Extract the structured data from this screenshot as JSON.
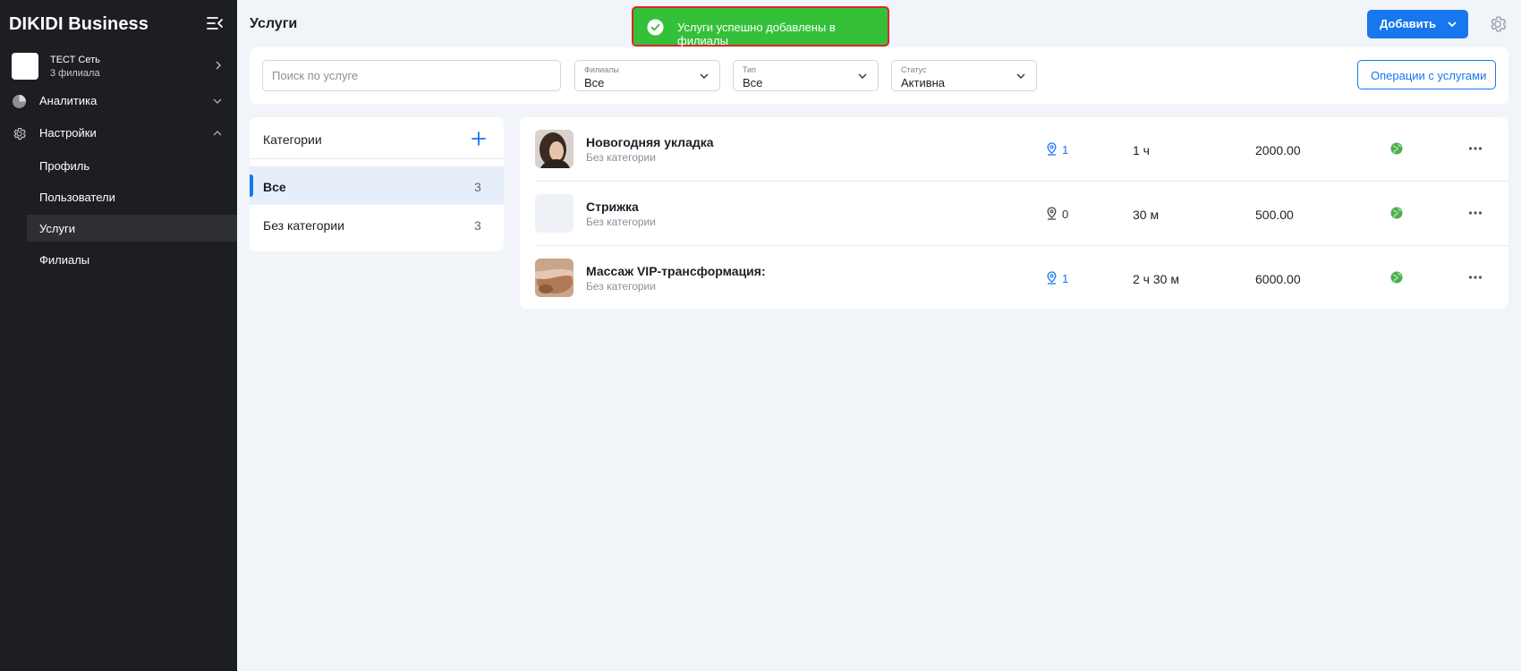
{
  "app": {
    "brand": "DIKIDI Business"
  },
  "org": {
    "name": "ТЕСТ Сеть",
    "subtitle": "3 филиала"
  },
  "nav": {
    "analytics": "Аналитика",
    "settings": "Настройки",
    "sub_items": [
      "Профиль",
      "Пользователи",
      "Услуги",
      "Филиалы"
    ],
    "active": "Услуги"
  },
  "header": {
    "title": "Услуги",
    "add_label": "Добавить"
  },
  "toast": {
    "text": "Услуги успешно добавлены в филиалы",
    "color": "#35c03a"
  },
  "filters": {
    "search_placeholder": "Поиск по услуге",
    "branches_caption": "Филиалы",
    "branches_value": "Все",
    "type_caption": "Тип",
    "type_value": "Все",
    "status_caption": "Статус",
    "status_value": "Активна",
    "operations_label": "Операции с услугами"
  },
  "categories": {
    "title": "Категории",
    "items": [
      {
        "name": "Все",
        "count": "3"
      },
      {
        "name": "Без категории",
        "count": "3"
      }
    ]
  },
  "services": [
    {
      "name": "Новогодняя укладка",
      "category": "Без категории",
      "branches": "1",
      "duration": "1 ч",
      "price": "2000.00",
      "thumb": "woman-hair-photo"
    },
    {
      "name": "Стрижка",
      "category": "Без категории",
      "branches": "0",
      "duration": "30 м",
      "price": "500.00",
      "thumb": "empty"
    },
    {
      "name": "Массаж VIP-трансформация:",
      "category": "Без категории",
      "branches": "1",
      "duration": "2 ч 30 м",
      "price": "6000.00",
      "thumb": "massage-photo"
    }
  ],
  "colors": {
    "accent": "#1677ef",
    "sidebar": "#1d1e22",
    "globe": "#4caf50"
  }
}
